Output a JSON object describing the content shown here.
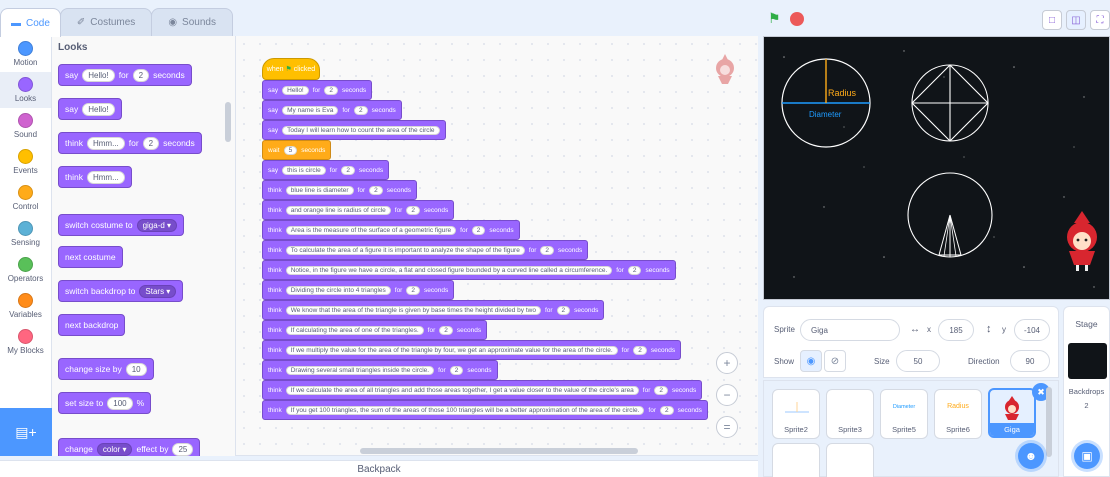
{
  "tabs": {
    "code": "Code",
    "costumes": "Costumes",
    "sounds": "Sounds"
  },
  "categories": [
    {
      "label": "Motion",
      "color": "#4c97ff"
    },
    {
      "label": "Looks",
      "color": "#9966ff"
    },
    {
      "label": "Sound",
      "color": "#cf63cf"
    },
    {
      "label": "Events",
      "color": "#ffbf00"
    },
    {
      "label": "Control",
      "color": "#ffab19"
    },
    {
      "label": "Sensing",
      "color": "#5cb1d6"
    },
    {
      "label": "Operators",
      "color": "#59c059"
    },
    {
      "label": "Variables",
      "color": "#ff8c1a"
    },
    {
      "label": "My Blocks",
      "color": "#ff6680"
    }
  ],
  "palette": {
    "title": "Looks",
    "say_for": {
      "say": "say",
      "msg": "Hello!",
      "for": "for",
      "secs": "2",
      "unit": "seconds"
    },
    "say": {
      "say": "say",
      "msg": "Hello!"
    },
    "think_for": {
      "think": "think",
      "msg": "Hmm...",
      "for": "for",
      "secs": "2",
      "unit": "seconds"
    },
    "think": {
      "think": "think",
      "msg": "Hmm..."
    },
    "switch_costume": {
      "label": "switch costume to",
      "value": "giga-d"
    },
    "next_costume": "next costume",
    "switch_backdrop": {
      "label": "switch backdrop to",
      "value": "Stars"
    },
    "next_backdrop": "next backdrop",
    "change_size": {
      "label": "change size by",
      "value": "10"
    },
    "set_size": {
      "label": "set size to",
      "value": "100",
      "unit": "%"
    },
    "change_effect": {
      "label": "change",
      "effect": "color",
      "by": "effect by",
      "value": "25"
    }
  },
  "script": {
    "hat": {
      "when": "when",
      "clicked": "clicked"
    },
    "blocks": [
      {
        "kind": "say",
        "text": "Hello!",
        "secs": "2"
      },
      {
        "kind": "say",
        "text": "My name is Eva",
        "secs": "2"
      },
      {
        "kind": "say",
        "text": "Today I will learn how to count the area of the circle",
        "secs": ""
      },
      {
        "kind": "wait",
        "text": "",
        "secs": "5"
      },
      {
        "kind": "say",
        "text": "this is circle",
        "secs": "2"
      },
      {
        "kind": "think",
        "text": "blue line is diameter",
        "secs": "2"
      },
      {
        "kind": "think",
        "text": "and orange line is radius of circle",
        "secs": "2"
      },
      {
        "kind": "think",
        "text": "Area is the measure of the surface of a geometric figure",
        "secs": "2"
      },
      {
        "kind": "think",
        "text": "To calculate the area of a figure it is important to analyze the shape of the figure",
        "secs": "2"
      },
      {
        "kind": "think",
        "text": "Notice, in the figure we have a circle, a flat and closed figure bounded by a curved line called a circumference.",
        "secs": "2"
      },
      {
        "kind": "think",
        "text": "Dividing the circle into 4 triangles",
        "secs": "2"
      },
      {
        "kind": "think",
        "text": "We know that the area of the triangle is given by base times the height divided by two",
        "secs": "2"
      },
      {
        "kind": "think",
        "text": "If calculating the area of one of the triangles.",
        "secs": "2"
      },
      {
        "kind": "think",
        "text": "If we multiply the value for the area of the triangle by four, we get an approximate value for the area of the circle.",
        "secs": "2"
      },
      {
        "kind": "think",
        "text": "Drawing several small triangles inside the circle.",
        "secs": "2"
      },
      {
        "kind": "think",
        "text": "If we calculate the area of all triangles and add those areas together, I get a value closer to the value of the circle's area",
        "secs": "2"
      },
      {
        "kind": "think",
        "text": "If you get 100 triangles, the sum of the areas of those 100 triangles will be a better approximation of the area of the circle.",
        "secs": "2"
      }
    ],
    "for_word": "for",
    "seconds_word": "seconds",
    "wait_word": "wait"
  },
  "zoom": {
    "in": "+",
    "out": "−",
    "reset": "="
  },
  "backpack": "Backpack",
  "stage_labels": {
    "radius": "Radius",
    "diameter": "Diameter"
  },
  "sprite_info": {
    "sprite_label": "Sprite",
    "sprite_name": "Giga",
    "x_label": "x",
    "x": "185",
    "y_label": "y",
    "y": "-104",
    "show_label": "Show",
    "size_label": "Size",
    "size": "50",
    "direction_label": "Direction",
    "direction": "90"
  },
  "sprites": [
    {
      "name": "Sprite2",
      "thumb": ""
    },
    {
      "name": "Sprite3",
      "thumb": ""
    },
    {
      "name": "Sprite5",
      "thumb": "Diameter"
    },
    {
      "name": "Sprite6",
      "thumb": "Radius"
    },
    {
      "name": "Giga",
      "thumb": ""
    }
  ],
  "stage_panel": {
    "title": "Stage",
    "backdrops_label": "Backdrops",
    "backdrops_count": "2"
  },
  "colors": {
    "looks": "#9966ff",
    "control": "#ffab19",
    "events": "#ffbf00",
    "accent": "#4c97ff"
  }
}
